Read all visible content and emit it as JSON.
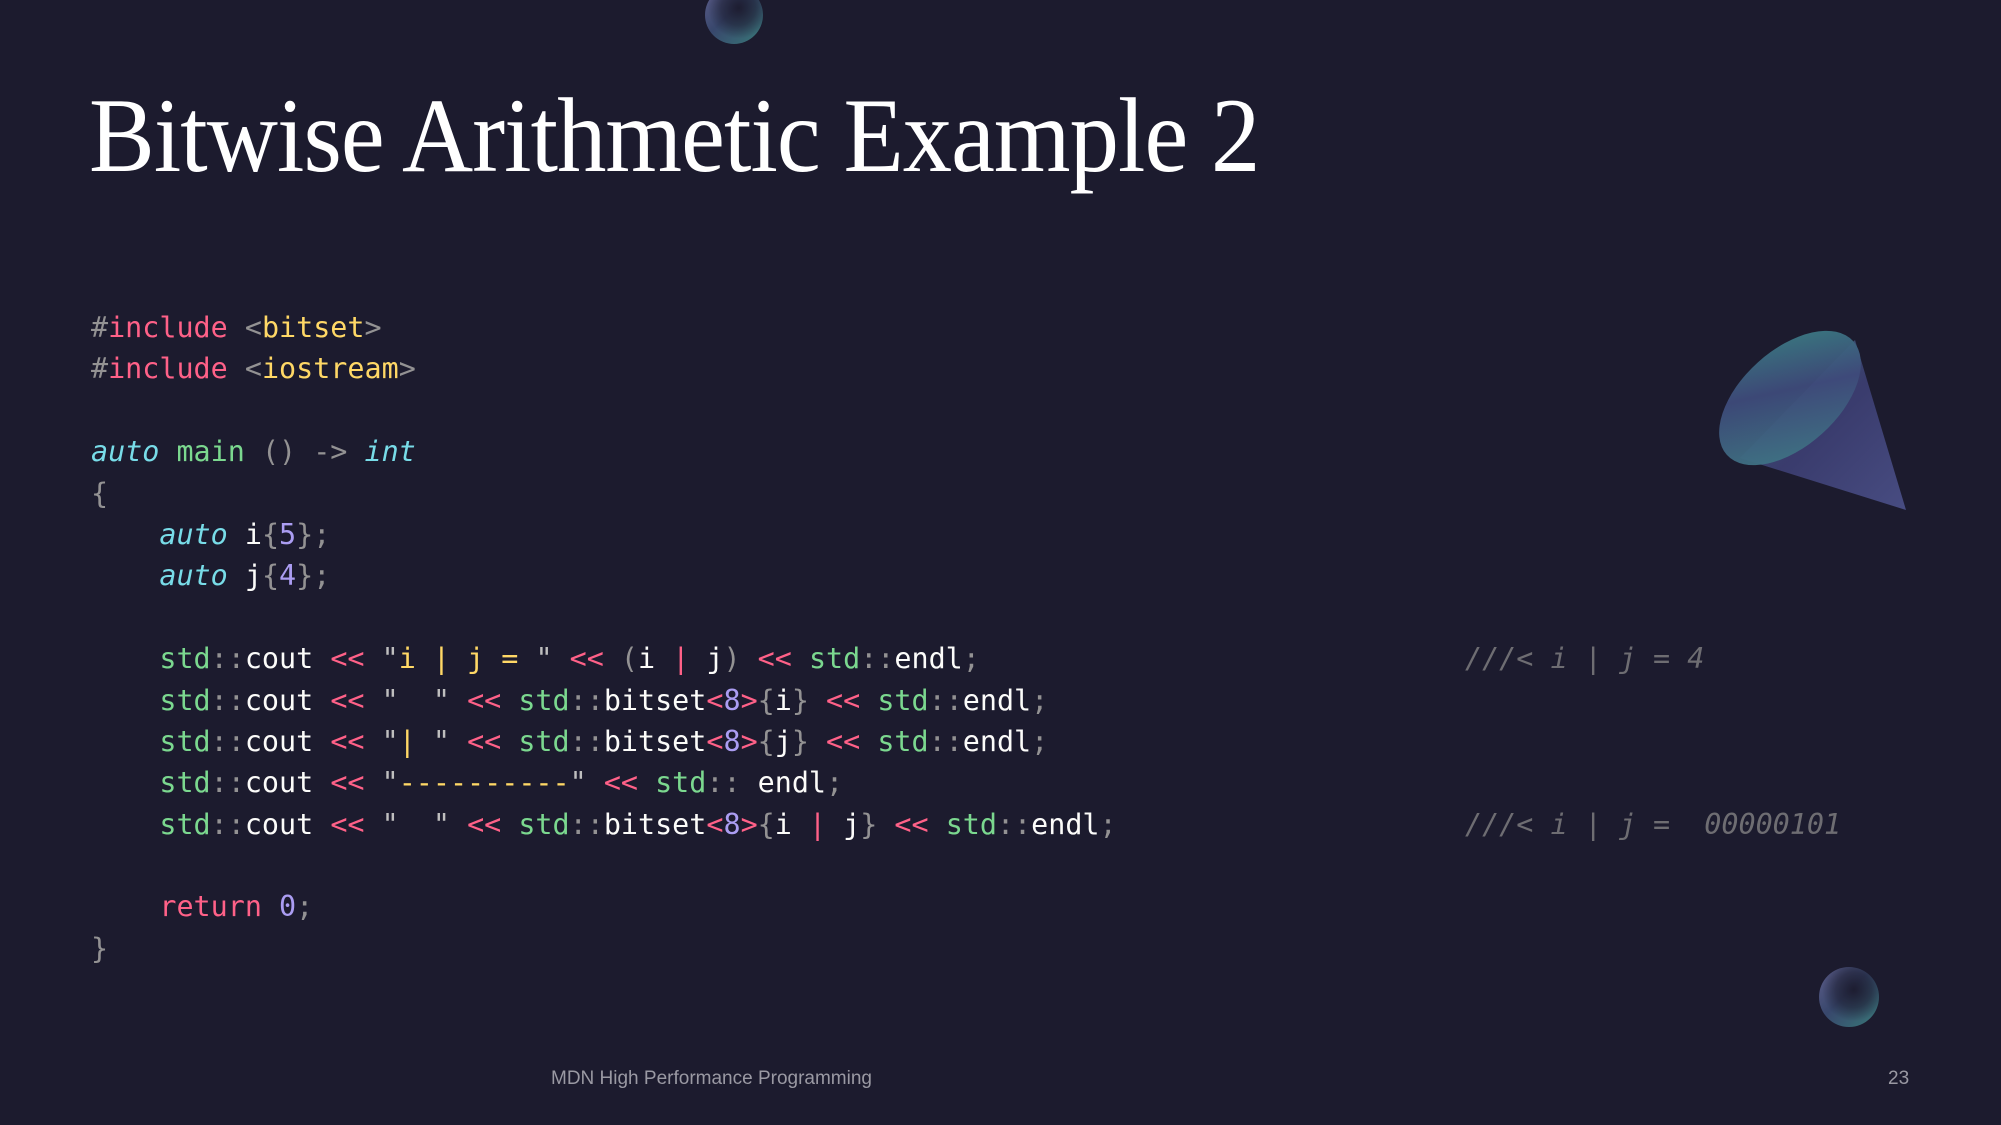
{
  "slide": {
    "title": "Bitwise Arithmetic Example 2",
    "footer": "MDN High Performance Programming",
    "page_number": "23",
    "colors": {
      "background": "#1c1b2e",
      "keyword": "#ff6188",
      "string": "#ffd866",
      "type": "#78dce8",
      "function": "#7bd88f",
      "number": "#ab9df2",
      "punctuation": "#939293",
      "comment": "#6e6d72",
      "text": "#fcfcfa"
    }
  },
  "code": {
    "language": "cpp",
    "lines": [
      [
        [
          "preproc",
          "#"
        ],
        [
          "keyword",
          "include"
        ],
        [
          "space",
          " "
        ],
        [
          "angle",
          "<"
        ],
        [
          "header",
          "bitset"
        ],
        [
          "angle",
          ">"
        ]
      ],
      [
        [
          "preproc",
          "#"
        ],
        [
          "keyword",
          "include"
        ],
        [
          "space",
          " "
        ],
        [
          "angle",
          "<"
        ],
        [
          "header",
          "iostream"
        ],
        [
          "angle",
          ">"
        ]
      ],
      [],
      [
        [
          "type",
          "auto"
        ],
        [
          "space",
          " "
        ],
        [
          "func",
          "main"
        ],
        [
          "space",
          " "
        ],
        [
          "punct",
          "()"
        ],
        [
          "space",
          " "
        ],
        [
          "punct",
          "->"
        ],
        [
          "space",
          " "
        ],
        [
          "type",
          "int"
        ]
      ],
      [
        [
          "punct",
          "{"
        ]
      ],
      [
        [
          "space",
          "    "
        ],
        [
          "type",
          "auto"
        ],
        [
          "space",
          " "
        ],
        [
          "ident",
          "i"
        ],
        [
          "punct",
          "{"
        ],
        [
          "number",
          "5"
        ],
        [
          "punct",
          "};"
        ]
      ],
      [
        [
          "space",
          "    "
        ],
        [
          "type",
          "auto"
        ],
        [
          "space",
          " "
        ],
        [
          "ident",
          "j"
        ],
        [
          "punct",
          "{"
        ],
        [
          "number",
          "4"
        ],
        [
          "punct",
          "};"
        ]
      ],
      [],
      [
        [
          "space",
          "    "
        ],
        [
          "ns",
          "std"
        ],
        [
          "punct",
          "::"
        ],
        [
          "ident",
          "cout"
        ],
        [
          "space",
          " "
        ],
        [
          "op",
          "<<"
        ],
        [
          "space",
          " "
        ],
        [
          "quote",
          "\""
        ],
        [
          "string",
          "i | j = "
        ],
        [
          "quote",
          "\""
        ],
        [
          "space",
          " "
        ],
        [
          "op",
          "<<"
        ],
        [
          "space",
          " "
        ],
        [
          "punct",
          "("
        ],
        [
          "ident",
          "i"
        ],
        [
          "space",
          " "
        ],
        [
          "op",
          "|"
        ],
        [
          "space",
          " "
        ],
        [
          "ident",
          "j"
        ],
        [
          "punct",
          ")"
        ],
        [
          "space",
          " "
        ],
        [
          "op",
          "<<"
        ],
        [
          "space",
          " "
        ],
        [
          "ns",
          "std"
        ],
        [
          "punct",
          "::"
        ],
        [
          "ident",
          "endl"
        ],
        [
          "punct",
          ";"
        ],
        [
          "comment",
          "///< i | j = 4"
        ]
      ],
      [
        [
          "space",
          "    "
        ],
        [
          "ns",
          "std"
        ],
        [
          "punct",
          "::"
        ],
        [
          "ident",
          "cout"
        ],
        [
          "space",
          " "
        ],
        [
          "op",
          "<<"
        ],
        [
          "space",
          " "
        ],
        [
          "quote",
          "\""
        ],
        [
          "string",
          "  "
        ],
        [
          "quote",
          "\""
        ],
        [
          "space",
          " "
        ],
        [
          "op",
          "<<"
        ],
        [
          "space",
          " "
        ],
        [
          "ns",
          "std"
        ],
        [
          "punct",
          "::"
        ],
        [
          "ident",
          "bitset"
        ],
        [
          "op",
          "<"
        ],
        [
          "number",
          "8"
        ],
        [
          "op",
          ">"
        ],
        [
          "punct",
          "{"
        ],
        [
          "ident",
          "i"
        ],
        [
          "punct",
          "}"
        ],
        [
          "space",
          " "
        ],
        [
          "op",
          "<<"
        ],
        [
          "space",
          " "
        ],
        [
          "ns",
          "std"
        ],
        [
          "punct",
          "::"
        ],
        [
          "ident",
          "endl"
        ],
        [
          "punct",
          ";"
        ]
      ],
      [
        [
          "space",
          "    "
        ],
        [
          "ns",
          "std"
        ],
        [
          "punct",
          "::"
        ],
        [
          "ident",
          "cout"
        ],
        [
          "space",
          " "
        ],
        [
          "op",
          "<<"
        ],
        [
          "space",
          " "
        ],
        [
          "quote",
          "\""
        ],
        [
          "string",
          "| "
        ],
        [
          "quote",
          "\""
        ],
        [
          "space",
          " "
        ],
        [
          "op",
          "<<"
        ],
        [
          "space",
          " "
        ],
        [
          "ns",
          "std"
        ],
        [
          "punct",
          "::"
        ],
        [
          "ident",
          "bitset"
        ],
        [
          "op",
          "<"
        ],
        [
          "number",
          "8"
        ],
        [
          "op",
          ">"
        ],
        [
          "punct",
          "{"
        ],
        [
          "ident",
          "j"
        ],
        [
          "punct",
          "}"
        ],
        [
          "space",
          " "
        ],
        [
          "op",
          "<<"
        ],
        [
          "space",
          " "
        ],
        [
          "ns",
          "std"
        ],
        [
          "punct",
          "::"
        ],
        [
          "ident",
          "endl"
        ],
        [
          "punct",
          ";"
        ]
      ],
      [
        [
          "space",
          "    "
        ],
        [
          "ns",
          "std"
        ],
        [
          "punct",
          "::"
        ],
        [
          "ident",
          "cout"
        ],
        [
          "space",
          " "
        ],
        [
          "op",
          "<<"
        ],
        [
          "space",
          " "
        ],
        [
          "quote",
          "\""
        ],
        [
          "string",
          "----------"
        ],
        [
          "quote",
          "\""
        ],
        [
          "space",
          " "
        ],
        [
          "op",
          "<<"
        ],
        [
          "space",
          " "
        ],
        [
          "ns",
          "std"
        ],
        [
          "punct",
          "::"
        ],
        [
          "space",
          " "
        ],
        [
          "ident",
          "endl"
        ],
        [
          "punct",
          ";"
        ]
      ],
      [
        [
          "space",
          "    "
        ],
        [
          "ns",
          "std"
        ],
        [
          "punct",
          "::"
        ],
        [
          "ident",
          "cout"
        ],
        [
          "space",
          " "
        ],
        [
          "op",
          "<<"
        ],
        [
          "space",
          " "
        ],
        [
          "quote",
          "\""
        ],
        [
          "string",
          "  "
        ],
        [
          "quote",
          "\""
        ],
        [
          "space",
          " "
        ],
        [
          "op",
          "<<"
        ],
        [
          "space",
          " "
        ],
        [
          "ns",
          "std"
        ],
        [
          "punct",
          "::"
        ],
        [
          "ident",
          "bitset"
        ],
        [
          "op",
          "<"
        ],
        [
          "number",
          "8"
        ],
        [
          "op",
          ">"
        ],
        [
          "punct",
          "{"
        ],
        [
          "ident",
          "i"
        ],
        [
          "space",
          " "
        ],
        [
          "op",
          "|"
        ],
        [
          "space",
          " "
        ],
        [
          "ident",
          "j"
        ],
        [
          "punct",
          "}"
        ],
        [
          "space",
          " "
        ],
        [
          "op",
          "<<"
        ],
        [
          "space",
          " "
        ],
        [
          "ns",
          "std"
        ],
        [
          "punct",
          "::"
        ],
        [
          "ident",
          "endl"
        ],
        [
          "punct",
          ";"
        ],
        [
          "comment",
          "///< i | j =  00000101"
        ]
      ],
      [],
      [
        [
          "space",
          "    "
        ],
        [
          "keyword",
          "return"
        ],
        [
          "space",
          " "
        ],
        [
          "number",
          "0"
        ],
        [
          "punct",
          ";"
        ]
      ],
      [
        [
          "punct",
          "}"
        ]
      ]
    ]
  },
  "decorations": {
    "top_sphere_icon": "sphere",
    "cone_icon": "cone",
    "bottom_sphere_icon": "sphere"
  }
}
